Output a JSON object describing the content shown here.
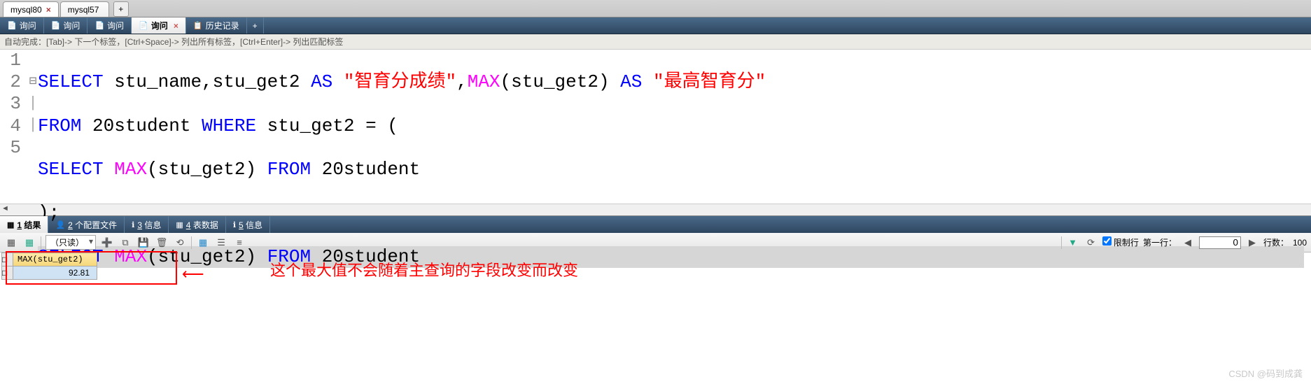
{
  "file_tabs": {
    "items": [
      {
        "label": "mysql80",
        "active": true,
        "closable": true
      },
      {
        "label": "mysql57",
        "active": false,
        "closable": false
      }
    ]
  },
  "query_tabs": {
    "items": [
      {
        "label": "询问",
        "active": false,
        "icon_color": "#7fb0d6"
      },
      {
        "label": "询问",
        "active": false,
        "icon_color": "#7fb0d6"
      },
      {
        "label": "询问",
        "active": false,
        "icon_color": "#7fb0d6"
      },
      {
        "label": "询问",
        "active": true,
        "icon_color": "#3070b0"
      },
      {
        "label": "历史记录",
        "active": false,
        "icon_color": "#ffffff"
      }
    ]
  },
  "hint": "自动完成：[Tab]-> 下一个标签，[Ctrl+Space]-> 列出所有标签，[Ctrl+Enter]-> 列出匹配标签",
  "code": {
    "line1": {
      "select": "SELECT",
      "cols": " stu_name,stu_get2 ",
      "as1": "AS",
      "str1": " \"智育分成绩\"",
      "comma": ",",
      "max": "MAX",
      "arg1": "(stu_get2) ",
      "as2": "AS",
      "str2": " \"最高智育分\""
    },
    "line2": {
      "from": "FROM",
      "tbl": " 20student ",
      "where": "WHERE",
      "cond": " stu_get2 = ("
    },
    "line3": {
      "select": "SELECT",
      "sp1": " ",
      "max": "MAX",
      "arg": "(stu_get2) ",
      "from": "FROM",
      "tbl": " 20student"
    },
    "line4": {
      "close": ");"
    },
    "line5": {
      "select": "SELECT",
      "sp1": " ",
      "max": "MAX",
      "arg": "(stu_get2) ",
      "from": "FROM",
      "tbl": " 20student"
    }
  },
  "gutter": [
    "1",
    "2",
    "3",
    "4",
    "5"
  ],
  "result_tabs": {
    "items": [
      {
        "mnemonic": "1",
        "label": " 结果",
        "active": true
      },
      {
        "mnemonic": "2",
        "label": " 个配置文件",
        "active": false
      },
      {
        "mnemonic": "3",
        "label": " 信息",
        "active": false
      },
      {
        "mnemonic": "4",
        "label": " 表数据",
        "active": false
      },
      {
        "mnemonic": "5",
        "label": " 信息",
        "active": false
      }
    ]
  },
  "toolbar": {
    "readonly_label": "（只读）",
    "limit_label": "限制行",
    "firstrow_label": "第一行：",
    "firstrow_value": "0",
    "rowcount_label": "行数：",
    "rowcount_value": "100"
  },
  "result": {
    "header": "MAX(stu_get2)",
    "value": "92.81"
  },
  "annotation": {
    "arrow": "⟵",
    "text": "这个最大值不会随着主查询的字段改变而改变"
  },
  "watermark": "CSDN @码到成龚"
}
